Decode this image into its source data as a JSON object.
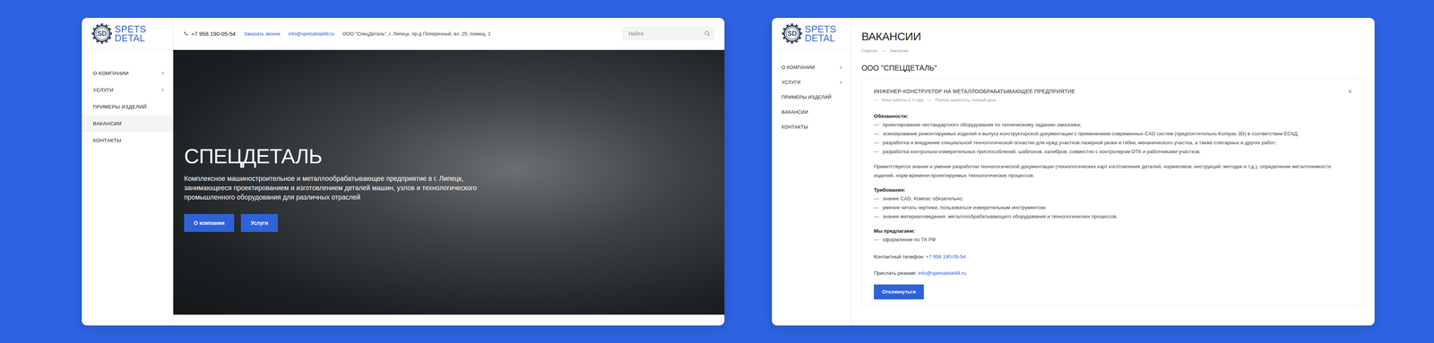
{
  "home_page": {
    "logo": {
      "mark": "SD",
      "line1": "SPETS",
      "line2": "DETAL"
    },
    "header": {
      "phone": "+7 958 190-05-54",
      "callback": "Заказать звонок",
      "email": "info@spetsdetal48.ru",
      "address": "ООО \"СпецДеталь\", г. Липецк,  пр-д Поперечный, вл. 25, помещ. 1"
    },
    "search": {
      "placeholder": "Найти"
    },
    "menu": [
      {
        "label": "О КОМПАНИИ",
        "has_submenu": true,
        "selected": false
      },
      {
        "label": "УСЛУГИ",
        "has_submenu": true,
        "selected": false
      },
      {
        "label": "ПРИМЕРЫ ИЗДЕЛИЙ",
        "has_submenu": false,
        "selected": false
      },
      {
        "label": "ВАКАНСИИ",
        "has_submenu": false,
        "selected": true
      },
      {
        "label": "КОНТАКТЫ",
        "has_submenu": false,
        "selected": false
      }
    ],
    "hero": {
      "title": "СПЕЦДЕТАЛЬ",
      "text": "Комплексное машиностроительное и металлообрабатывающее предприятие в г. Липецк, занимающееся проектированием и изготовлением деталей машин, узлов и технологического промышленного оборудования для различных отраслей",
      "buttons": [
        "О компании",
        "Услуги"
      ]
    }
  },
  "vacancies_page": {
    "logo": {
      "mark": "SD",
      "line1": "SPETS",
      "line2": "DETAL"
    },
    "menu": [
      {
        "label": "О КОМПАНИИ",
        "has_submenu": true,
        "selected": false
      },
      {
        "label": "УСЛУГИ",
        "has_submenu": true,
        "selected": false
      },
      {
        "label": "ПРИМЕРЫ ИЗДЕЛИЙ",
        "has_submenu": false,
        "selected": false
      },
      {
        "label": "ВАКАНСИИ",
        "has_submenu": false,
        "selected": false
      },
      {
        "label": "КОНТАКТЫ",
        "has_submenu": false,
        "selected": false
      }
    ],
    "title": "ВАКАНСИИ",
    "breadcrumbs": [
      "Главная",
      "—",
      "Вакансии"
    ],
    "company": "ООО \"СПЕЦДЕТАЛЬ\"",
    "vacancy": {
      "title": "ИНЖЕНЕР-КОНСТРУКТОР НА МЕТАЛЛООБРАБАТЫВАЮЩЕЕ ПРЕДПРИЯТИЕ",
      "close": "×",
      "meta": [
        "—",
        "Опыт работы 1-3 года",
        "—",
        "Полная занятость, полный день"
      ],
      "bullet": "—",
      "duties_heading": "Обязанности:",
      "duties": [
        "проектирование нестандартного оборудования по техническому заданию заказчика;",
        "эскизирование ремонтируемых изделий и выпуск конструкторской документации с применением современных CAD систем (предпочтительно Kompas 3D) в соответствии ЕСКД;",
        "разработка и внедрение специальной технологической оснастки для нужд участков лазерной резки и гибки, механического участка, а также слесарных и других работ;",
        "разработка контрольно-измерительных приспособлений, шаблонов, калибров, совместно с контролером ОТК и работниками участков."
      ],
      "note": "Приветствуется знание и умение разработки технологической документации (технологических карт изготовления деталей, нормативов, инструкций, методик и т.д.), определение металлоемкости изделий, норм времени проектируемых технологических процессов.",
      "requirements_heading": "Требования:",
      "requirements": [
        "знание CAD, Компас обязательно;",
        "умение читать чертежи, пользоваться измерительным инструментом;",
        "знание материаловедения, металлообрабатывающего оборудования и технологических процессов."
      ],
      "offer_heading": "Мы предлагаем:",
      "offer": [
        "оформление по ТК РФ"
      ],
      "phone_label": "Контактный телефон:",
      "phone": "+7 958 190-05-54",
      "resume_label": "Прислать резюме:",
      "email": "info@spetsdetal48.ru",
      "apply": "Откликнуться"
    }
  }
}
